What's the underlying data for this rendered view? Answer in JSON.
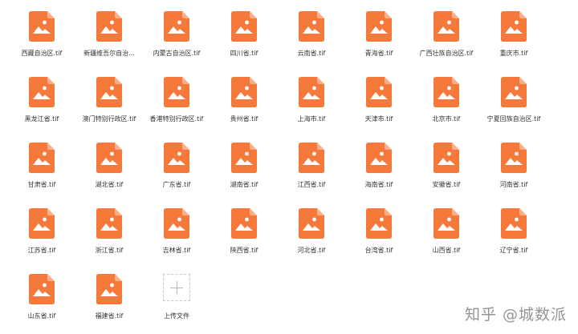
{
  "files": [
    {
      "name": "西藏自治区.tif"
    },
    {
      "name": "新疆维吾尔自治..."
    },
    {
      "name": "内蒙古自治区.tif"
    },
    {
      "name": "四川省.tif"
    },
    {
      "name": "云南省.tif"
    },
    {
      "name": "青海省.tif"
    },
    {
      "name": "广西壮族自治区.tif"
    },
    {
      "name": "重庆市.tif"
    },
    {
      "name": "黑龙江省.tif"
    },
    {
      "name": "澳门特别行政区.tif"
    },
    {
      "name": "香港特别行政区.tif"
    },
    {
      "name": "贵州省.tif"
    },
    {
      "name": "上海市.tif"
    },
    {
      "name": "天津市.tif"
    },
    {
      "name": "北京市.tif"
    },
    {
      "name": "宁夏回族自治区.tif"
    },
    {
      "name": "甘肃省.tif"
    },
    {
      "name": "湖北省.tif"
    },
    {
      "name": "广东省.tif"
    },
    {
      "name": "湖南省.tif"
    },
    {
      "name": "江西省.tif"
    },
    {
      "name": "海南省.tif"
    },
    {
      "name": "安徽省.tif"
    },
    {
      "name": "河南省.tif"
    },
    {
      "name": "江苏省.tif"
    },
    {
      "name": "浙江省.tif"
    },
    {
      "name": "吉林省.tif"
    },
    {
      "name": "陕西省.tif"
    },
    {
      "name": "河北省.tif"
    },
    {
      "name": "台湾省.tif"
    },
    {
      "name": "山西省.tif"
    },
    {
      "name": "辽宁省.tif"
    },
    {
      "name": "山东省.tif"
    },
    {
      "name": "福建省.tif"
    }
  ],
  "upload": {
    "label": "上传文件",
    "icon": "plus-icon"
  },
  "watermark": "知乎 @城数派",
  "colors": {
    "icon_orange": "#f4793b",
    "icon_fold": "#f9b08a",
    "text": "#333333"
  }
}
